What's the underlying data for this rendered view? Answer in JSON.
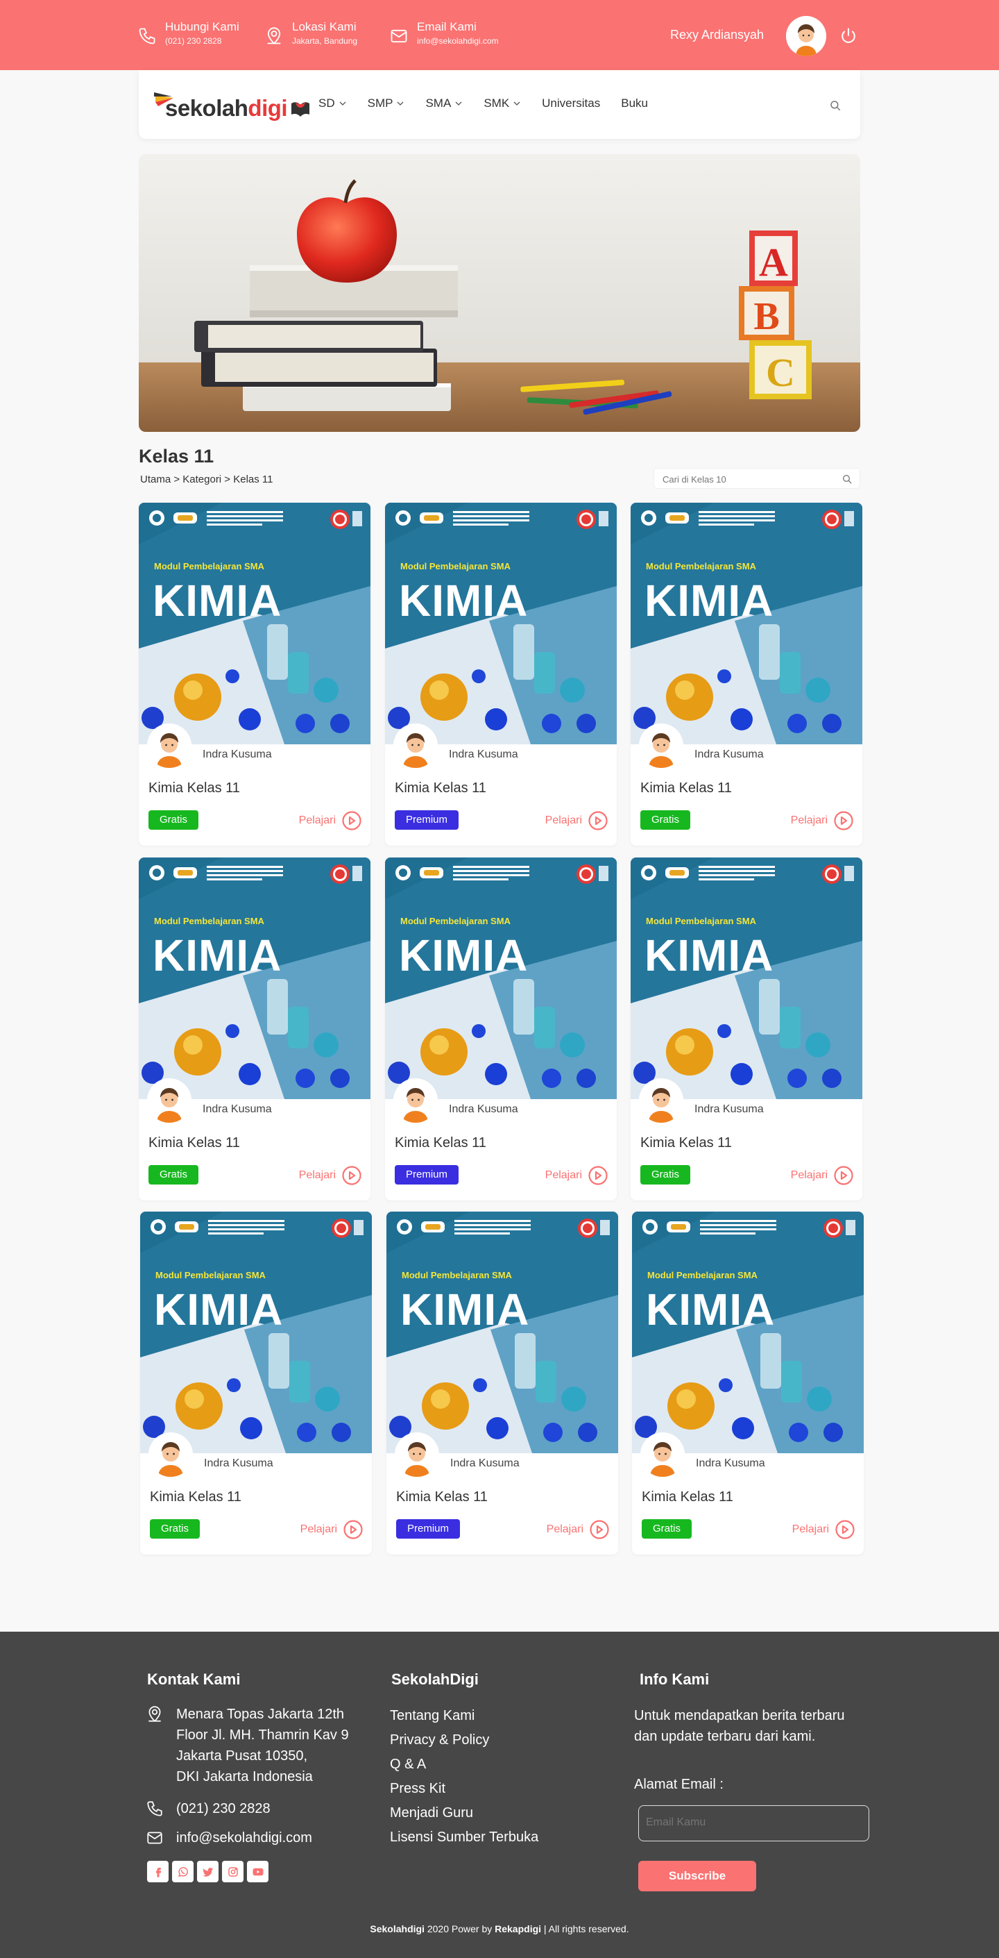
{
  "topbar": {
    "contact": {
      "title": "Hubungi Kami",
      "value": "(021) 230 2828",
      "icon": "phone-icon"
    },
    "location": {
      "title": "Lokasi Kami",
      "value": "Jakarta, Bandung",
      "icon": "location-icon"
    },
    "email": {
      "title": "Email Kami",
      "value": "info@sekolahdigi.com",
      "icon": "mail-icon"
    },
    "user_name": "Rexy Ardiansyah",
    "bg_color": "#fa7272"
  },
  "nav": {
    "logo_part1": "sekolah",
    "logo_part2": "digi",
    "items": [
      {
        "label": "SD",
        "dropdown": true
      },
      {
        "label": "SMP",
        "dropdown": true
      },
      {
        "label": "SMA",
        "dropdown": true
      },
      {
        "label": "SMK",
        "dropdown": true
      },
      {
        "label": "Universitas",
        "dropdown": false
      },
      {
        "label": "Buku",
        "dropdown": false
      }
    ]
  },
  "hero": {
    "blocks": [
      "A",
      "B",
      "C"
    ]
  },
  "page": {
    "title": "Kelas 11",
    "breadcrumb": "Utama > Kategori > Kelas 11",
    "search_placeholder": "Cari di Kelas 10"
  },
  "cards": [
    {
      "cover_subtitle": "Modul Pembelajaran SMA",
      "cover_title": "KIMIA",
      "author": "Indra Kusuma",
      "title": "Kimia Kelas 11",
      "badge": "Gratis",
      "badge_type": "free",
      "action": "Pelajari"
    },
    {
      "cover_subtitle": "Modul Pembelajaran SMA",
      "cover_title": "KIMIA",
      "author": "Indra Kusuma",
      "title": "Kimia Kelas 11",
      "badge": "Premium",
      "badge_type": "premium",
      "action": "Pelajari"
    },
    {
      "cover_subtitle": "Modul Pembelajaran SMA",
      "cover_title": "KIMIA",
      "author": "Indra Kusuma",
      "title": "Kimia Kelas 11",
      "badge": "Gratis",
      "badge_type": "free",
      "action": "Pelajari"
    },
    {
      "cover_subtitle": "Modul Pembelajaran SMA",
      "cover_title": "KIMIA",
      "author": "Indra Kusuma",
      "title": "Kimia Kelas 11",
      "badge": "Gratis",
      "badge_type": "free",
      "action": "Pelajari"
    },
    {
      "cover_subtitle": "Modul Pembelajaran SMA",
      "cover_title": "KIMIA",
      "author": "Indra Kusuma",
      "title": "Kimia Kelas 11",
      "badge": "Premium",
      "badge_type": "premium",
      "action": "Pelajari"
    },
    {
      "cover_subtitle": "Modul Pembelajaran SMA",
      "cover_title": "KIMIA",
      "author": "Indra Kusuma",
      "title": "Kimia Kelas 11",
      "badge": "Gratis",
      "badge_type": "free",
      "action": "Pelajari"
    },
    {
      "cover_subtitle": "Modul Pembelajaran SMA",
      "cover_title": "KIMIA",
      "author": "Indra Kusuma",
      "title": "Kimia Kelas 11",
      "badge": "Gratis",
      "badge_type": "free",
      "action": "Pelajari"
    },
    {
      "cover_subtitle": "Modul Pembelajaran SMA",
      "cover_title": "KIMIA",
      "author": "Indra Kusuma",
      "title": "Kimia Kelas 11",
      "badge": "Premium",
      "badge_type": "premium",
      "action": "Pelajari"
    },
    {
      "cover_subtitle": "Modul Pembelajaran SMA",
      "cover_title": "KIMIA",
      "author": "Indra Kusuma",
      "title": "Kimia Kelas 11",
      "badge": "Gratis",
      "badge_type": "free",
      "action": "Pelajari"
    }
  ],
  "footer": {
    "contact_heading": "Kontak Kami",
    "address_lines": [
      "Menara Topas Jakarta 12th",
      "Floor Jl. MH. Thamrin Kav 9",
      "Jakarta Pusat 10350,",
      "DKI Jakarta Indonesia"
    ],
    "phone": "(021) 230 2828",
    "email": "info@sekolahdigi.com",
    "brand_heading": "SekolahDigi",
    "links": [
      "Tentang Kami",
      "Privacy & Policy",
      "Q & A",
      "Press Kit",
      "Menjadi Guru",
      "Lisensi Sumber Terbuka"
    ],
    "info_heading": "Info Kami",
    "info_text": "Untuk mendapatkan berita terbaru dan update terbaru dari kami.",
    "email_label": "Alamat Email :",
    "email_placeholder": "Email Kamu",
    "subscribe_label": "Subscribe",
    "socials": [
      "facebook-icon",
      "whatsapp-icon",
      "twitter-icon",
      "instagram-icon",
      "youtube-icon"
    ],
    "copyright_brand": "Sekolahdigi",
    "copyright_mid": " 2020 Power by ",
    "copyright_power": "Rekapdigi",
    "copyright_end": " | All rights reserved."
  }
}
